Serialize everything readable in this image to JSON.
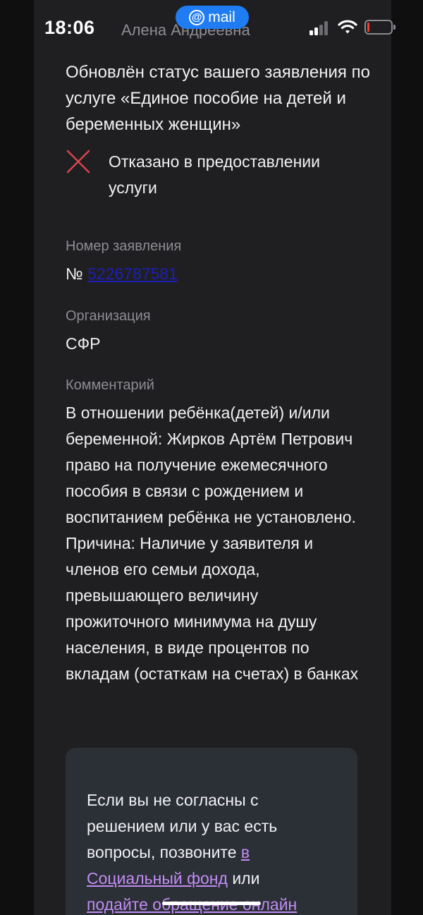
{
  "status_bar": {
    "time": "18:06",
    "app_badge": "mail",
    "app_badge_icon": "at-sign-icon",
    "battery_level_percent": 8,
    "colors": {
      "badge": "#1f7cf2",
      "battery_low": "#ff3b30"
    }
  },
  "message": {
    "partial_sender": "Алена Андреевна",
    "headline": "Обновлён статус вашего заявления по услуге «Единое пособие на детей и беременных женщин»",
    "status_text": "Отказано в предоставлении услуги",
    "status_icon": "cross-icon",
    "status_color": "#d9434c"
  },
  "fields": {
    "application_label": "Номер заявления",
    "application_prefix": "№",
    "application_number": "5226787581",
    "organization_label": "Организация",
    "organization_value": "СФР",
    "comment_label": "Комментарий",
    "comment_text": "В отношении ребёнка(детей) и/или беременной: Жирков Артём Петрович право на получение ежемесячного пособия в связи с рождением и воспитанием ребёнка не установлено. Причина: Наличие у заявителя и членов его семьи дохода, превышающего величину прожиточного минимума на душу населения, в виде процентов по вкладам (остаткам на счетах) в банках"
  },
  "info_box": {
    "text_before": "Если вы не согласны с решением или у вас есть вопросы, позвоните ",
    "link_fund": "в Социальный фонд",
    "text_middle": " или ",
    "link_appeal": "подайте обращение онлайн",
    "link_color": "#c38df3"
  }
}
